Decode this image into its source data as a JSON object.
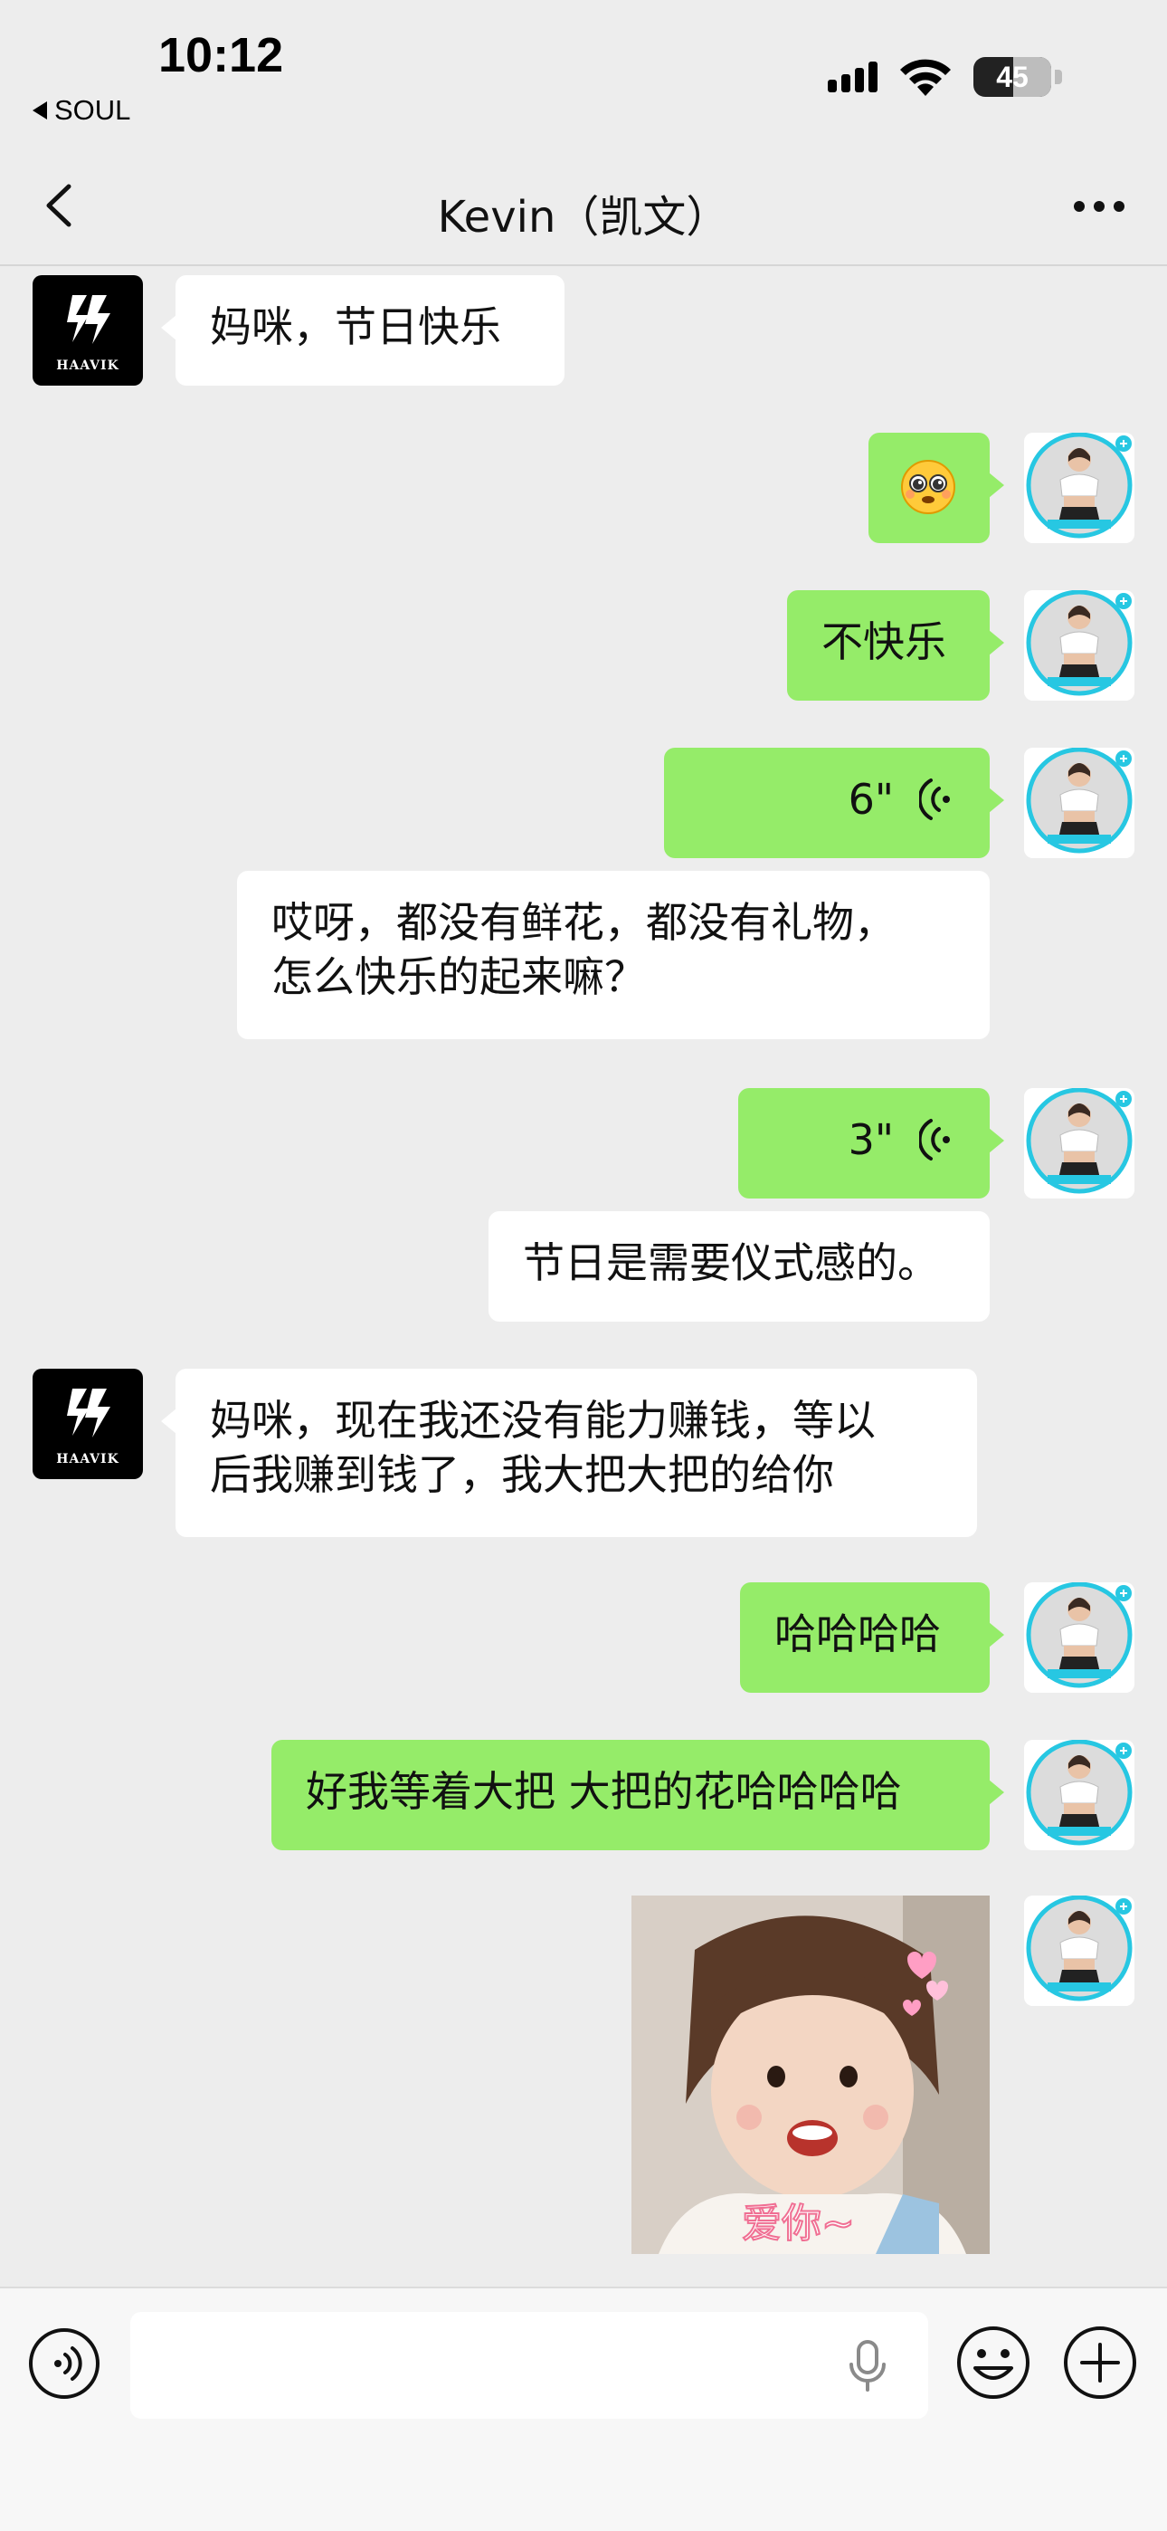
{
  "status_bar": {
    "time": "10:12",
    "back_app": "SOUL",
    "battery": "45"
  },
  "header": {
    "title": "Kevin（凯文）"
  },
  "contact_avatar": {
    "brand": "HAAVIK"
  },
  "messages": [
    {
      "side": "in",
      "type": "text",
      "text": "妈咪，节日快乐"
    },
    {
      "side": "out",
      "type": "emoji",
      "emoji": "pleading-face-emoji"
    },
    {
      "side": "out",
      "type": "text",
      "text": "不快乐"
    },
    {
      "side": "out",
      "type": "voice",
      "duration": "6\""
    },
    {
      "side": "out",
      "type": "text",
      "text": "哎呀，都没有鲜花，都没有礼物，\n怎么快乐的起来嘛？"
    },
    {
      "side": "out",
      "type": "voice",
      "duration": "3\""
    },
    {
      "side": "out",
      "type": "text",
      "text": "节日是需要仪式感的。"
    },
    {
      "side": "in",
      "type": "text",
      "text": "妈咪，现在我还没有能力赚钱，等以\n后我赚到钱了，我大把大把的给你"
    },
    {
      "side": "out",
      "type": "text",
      "text": "哈哈哈哈"
    },
    {
      "side": "out",
      "type": "text",
      "text": "好我等着大把 大把的花哈哈哈哈"
    },
    {
      "side": "out",
      "type": "image",
      "caption": "爱你~"
    }
  ],
  "input_bar": {
    "value": "",
    "placeholder": ""
  },
  "colors": {
    "background": "#ededed",
    "outgoing_bubble": "#95ec69",
    "incoming_bubble": "#ffffff",
    "input_bar": "#f7f7f7"
  },
  "icons": {
    "nav_back": "chevron-left-icon",
    "nav_more": "more-dots-icon",
    "voice_toggle": "voice-mode-icon",
    "mic": "mic-icon",
    "emoji": "emoji-icon",
    "plus": "plus-icon"
  }
}
